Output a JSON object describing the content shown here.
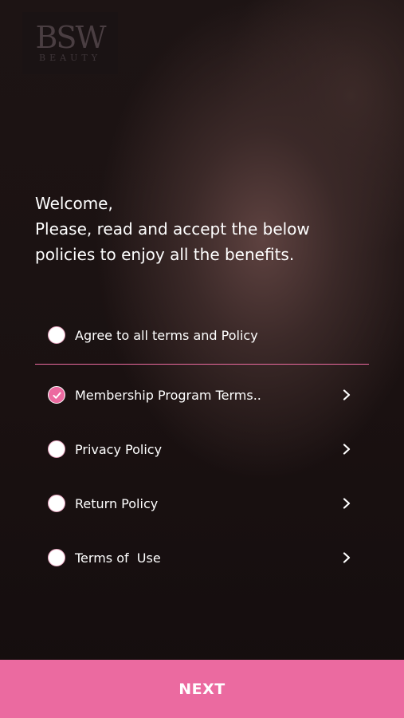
{
  "brand": {
    "logo_text": "BSW",
    "logo_subtext": "BEAUTY"
  },
  "welcome": {
    "line1": "Welcome,",
    "line2": "Please, read and accept the below",
    "line3": "policies to enjoy all the benefits."
  },
  "agree_all": {
    "label": "Agree to all terms and Policy",
    "checked": false
  },
  "policies": [
    {
      "label": "Membership Program Terms..",
      "checked": true,
      "icon": "chevron-right-icon"
    },
    {
      "label": "Privacy Policy",
      "checked": false,
      "icon": "chevron-right-icon"
    },
    {
      "label": "Return Policy",
      "checked": false,
      "icon": "chevron-right-icon"
    },
    {
      "label": "Terms of  Use",
      "checked": false,
      "icon": "chevron-right-icon"
    }
  ],
  "next_button": {
    "label": "NEXT"
  },
  "colors": {
    "accent": "#eb6aa0",
    "text": "#ffffff"
  }
}
